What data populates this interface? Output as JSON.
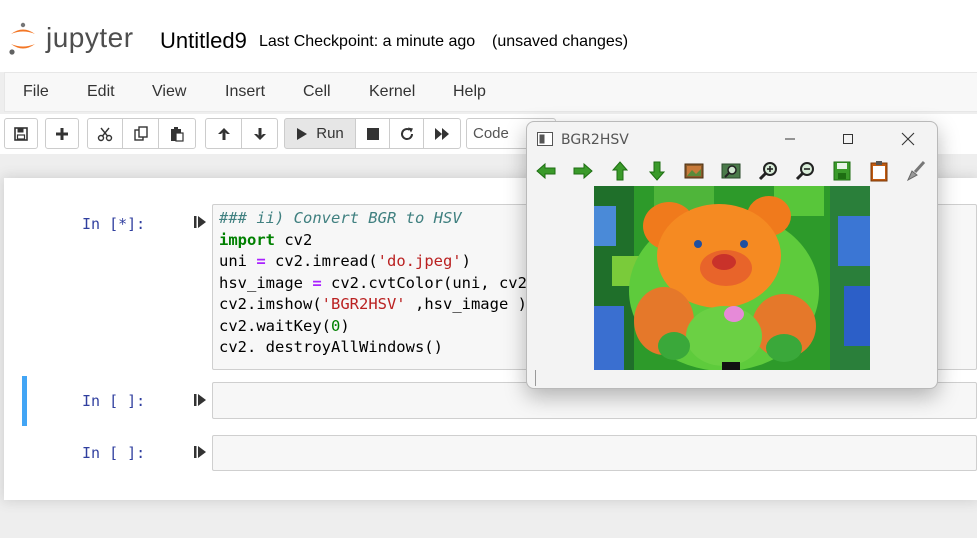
{
  "header": {
    "logo_text": "jupyter",
    "notebook_name": "Untitled9",
    "checkpoint": "Last Checkpoint: a minute ago",
    "save_status": "(unsaved changes)"
  },
  "menu": [
    "File",
    "Edit",
    "View",
    "Insert",
    "Cell",
    "Kernel",
    "Help"
  ],
  "toolbar": {
    "run_label": "Run",
    "cell_type": "Code",
    "icons": [
      "save-icon",
      "plus-icon",
      "cut-icon",
      "copy-icon",
      "paste-icon",
      "arrow-up-icon",
      "arrow-down-icon",
      "run-icon",
      "stop-icon",
      "restart-icon",
      "fast-forward-icon"
    ]
  },
  "cells": [
    {
      "prompt": "In [*]:",
      "lines": [
        [
          {
            "t": "### ii) Convert BGR to HSV",
            "c": "comment"
          }
        ],
        [
          {
            "t": "import",
            "c": "kw"
          },
          {
            "t": " cv2",
            "c": ""
          }
        ],
        [
          {
            "t": "uni ",
            "c": ""
          },
          {
            "t": "=",
            "c": "op"
          },
          {
            "t": " cv2.imread(",
            "c": ""
          },
          {
            "t": "'do.jpeg'",
            "c": "str"
          },
          {
            "t": ")",
            "c": ""
          }
        ],
        [
          {
            "t": "hsv_image ",
            "c": ""
          },
          {
            "t": "=",
            "c": "op"
          },
          {
            "t": " cv2.cvtColor(uni, cv2.",
            "c": ""
          }
        ],
        [
          {
            "t": "cv2.imshow(",
            "c": ""
          },
          {
            "t": "'BGR2HSV'",
            "c": "str"
          },
          {
            "t": " ,hsv_image )",
            "c": ""
          }
        ],
        [
          {
            "t": "cv2.waitKey(",
            "c": ""
          },
          {
            "t": "0",
            "c": "num"
          },
          {
            "t": ")",
            "c": ""
          }
        ],
        [
          {
            "t": "cv2. destroyAllWindows()",
            "c": ""
          }
        ]
      ]
    },
    {
      "prompt": "In [ ]:",
      "lines": []
    },
    {
      "prompt": "In [ ]:",
      "lines": []
    }
  ],
  "cv_window": {
    "title": "BGR2HSV",
    "tools": [
      "arrow-left-icon",
      "arrow-right-icon",
      "arrow-up-icon",
      "arrow-down-icon",
      "image-icon",
      "zoom-rect-icon",
      "zoom-in-icon",
      "zoom-out-icon",
      "save-icon",
      "clipboard-icon",
      "brush-icon"
    ]
  },
  "colors": {
    "prompt": "#303f9f",
    "selected_border": "#42a5f5",
    "jupyter_orange": "#f37726"
  }
}
